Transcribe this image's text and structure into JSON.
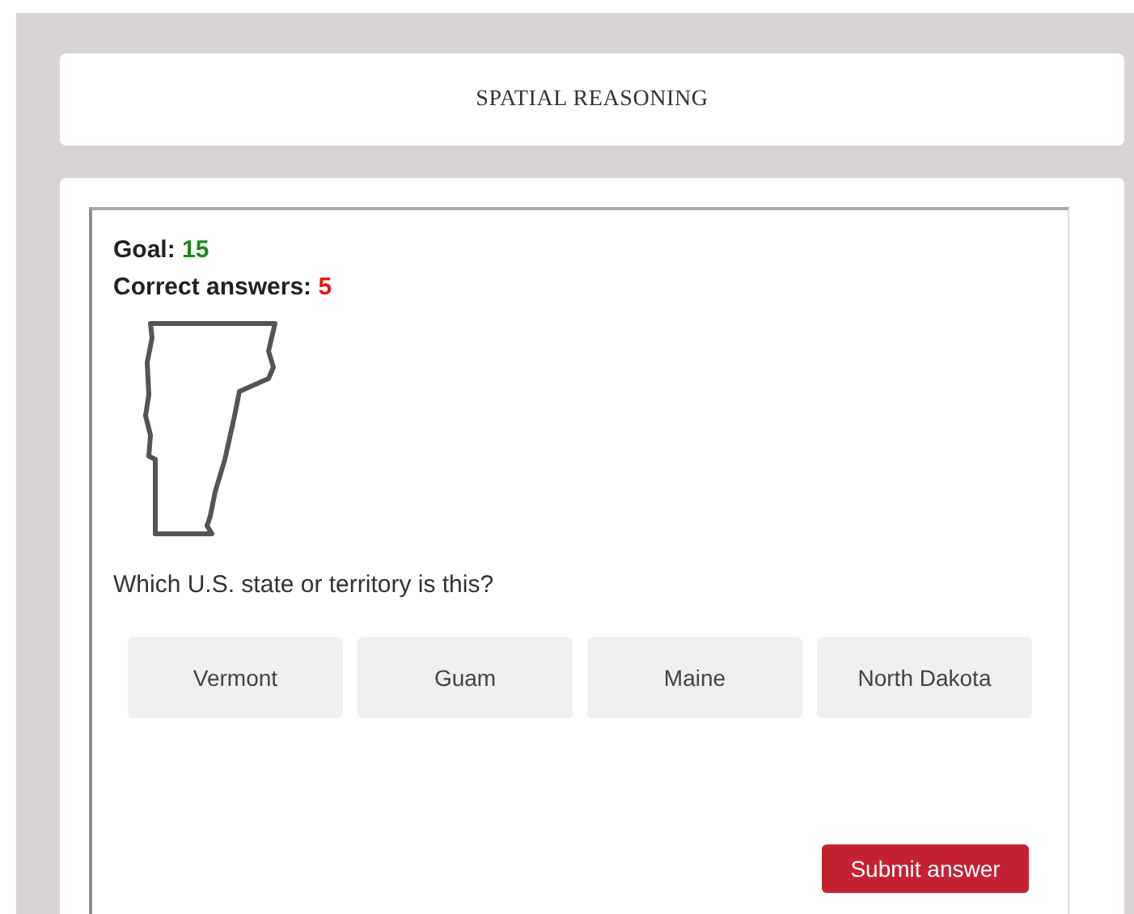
{
  "header": {
    "title": "SPATIAL REASONING"
  },
  "quiz": {
    "goal_label": "Goal:",
    "goal_value": "15",
    "correct_label": "Correct answers:",
    "correct_value": "5",
    "question": "Which U.S. state or territory is this?",
    "options": [
      {
        "label": "Vermont",
        "selected": false
      },
      {
        "label": "Guam",
        "selected": false
      },
      {
        "label": "Maine",
        "selected": false
      },
      {
        "label": "North Dakota",
        "selected": false
      }
    ],
    "submit": "Submit answer"
  }
}
